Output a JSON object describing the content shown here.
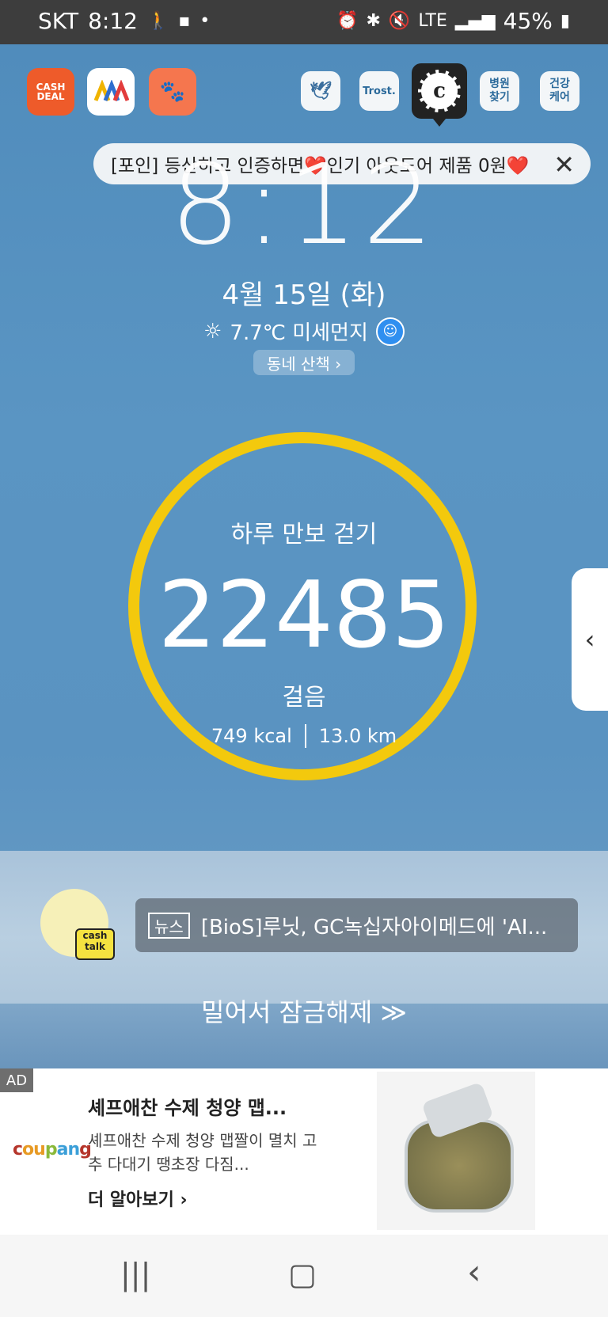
{
  "status_bar": {
    "carrier": "SKT",
    "time": "8:12",
    "network": "LTE",
    "battery": "45%"
  },
  "top_apps": {
    "cashdeal": "CASH DEAL",
    "hospital": "병원\n찾기",
    "health": "건강\n케어",
    "trost": "Trost."
  },
  "banner": {
    "text": "[포인] 등산하고 인증하면❤️인기 아웃도어 제품 0원❤️"
  },
  "lock": {
    "clock": "8:12",
    "date": "4월 15일 (화)",
    "weather": "7.7℃ 미세먼지",
    "walk_button": "동네 산책 ›"
  },
  "pedometer": {
    "title": "하루 만보 걷기",
    "steps": "22485",
    "unit": "걸음",
    "kcal": "749 kcal",
    "distance": "13.0 km"
  },
  "news": {
    "tag": "뉴스",
    "headline": "[BioS]루닛, GC녹십자아이메드에 'AI...",
    "avatar_label": "cash talk"
  },
  "unlock_text": "밀어서 잠금해제 ≫",
  "ad": {
    "tag": "AD",
    "brand": "coupang",
    "title": "셰프애찬 수제 청양 맵...",
    "desc": "셰프애찬 수제 청양 맵짤이 멸치 고추 다대기 땡초장 다짐...",
    "more": "더 알아보기 ›"
  },
  "colors": {
    "ring": "#f3c90d",
    "sky": "#5a93c1",
    "coupang_c": "#b5352b",
    "coupang_o": "#e79a24",
    "coupang_u": "#8ab93a",
    "coupang_p": "#3b9fd8"
  }
}
